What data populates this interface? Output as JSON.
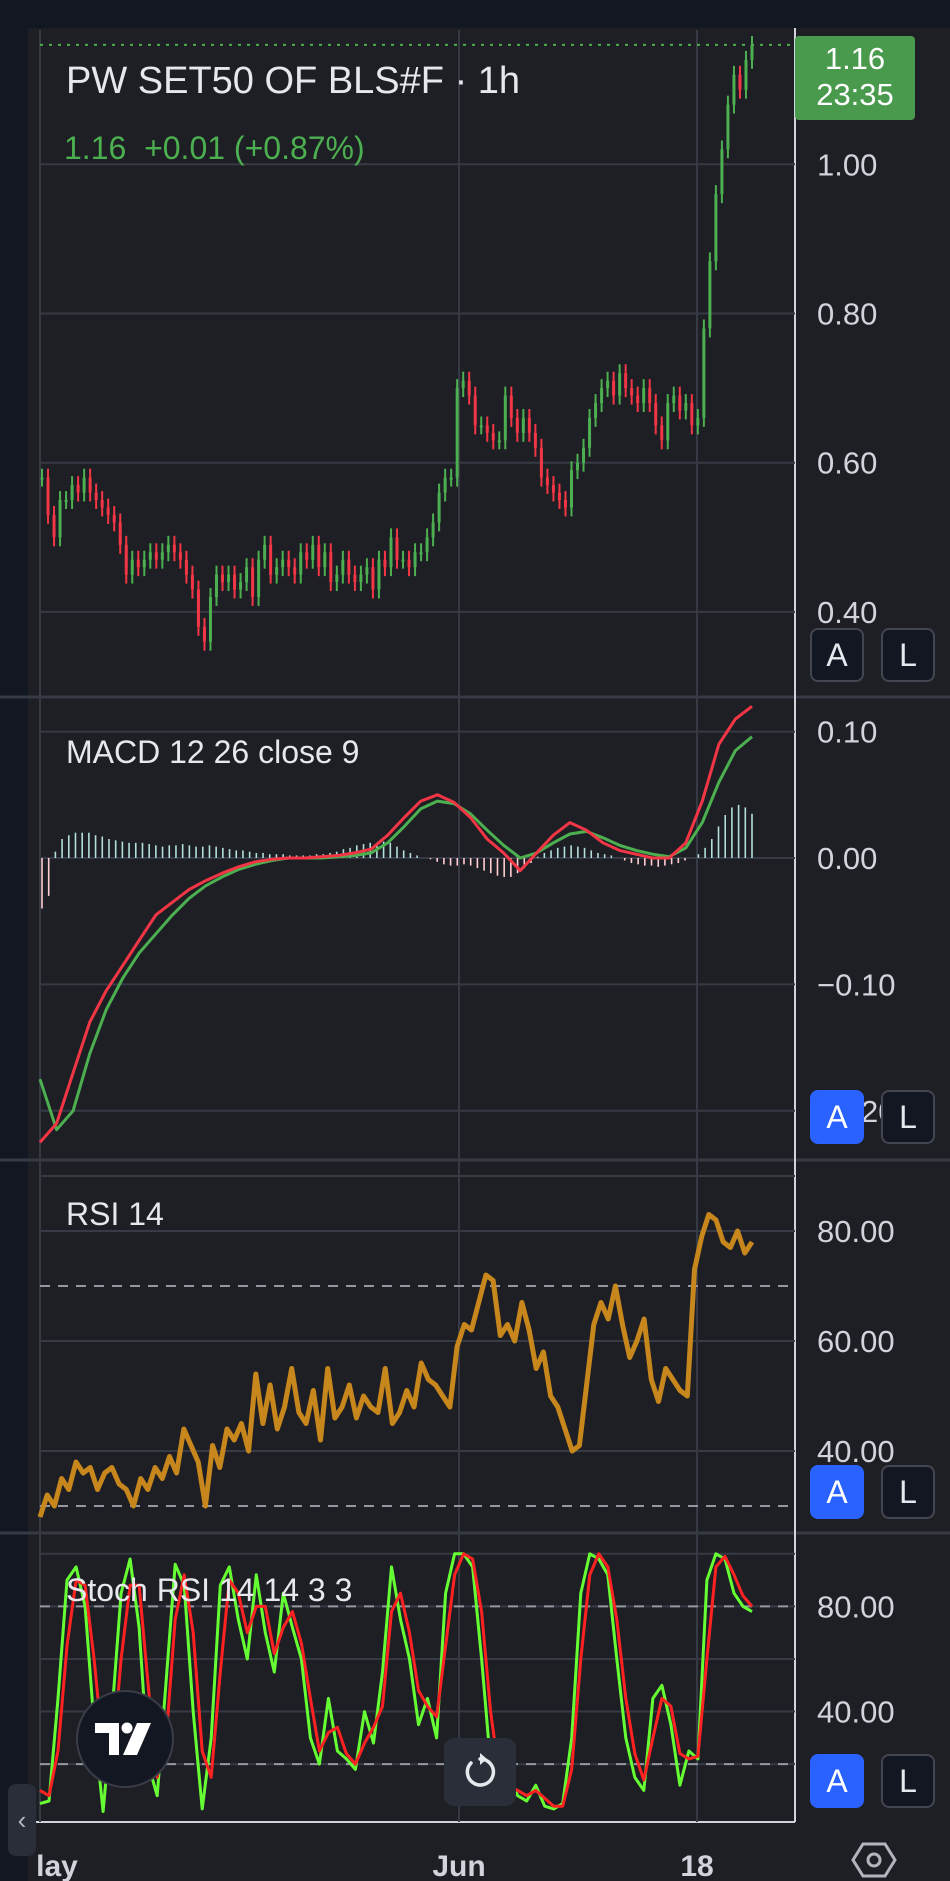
{
  "colors": {
    "background": "#1e1f24",
    "grid": "#363a45",
    "up": "#4caf50",
    "down": "#f23645",
    "macd": "#f23645",
    "signal": "#4caf50",
    "rsi": "#c7871c",
    "stoch_k": "#66ff33",
    "stoch_d": "#ff2222",
    "price_badge": "#4a9a4e",
    "button_active": "#2962ff"
  },
  "header": {
    "symbol": "PW SET50 OF BLS#F",
    "separator": "·",
    "interval": "1h",
    "last": "1.16",
    "change": "+0.01",
    "change_pct": "(+0.87%)"
  },
  "price_badge": {
    "price": "1.16",
    "countdown": "23:35"
  },
  "panes": {
    "macd_legend": "MACD 12 26 close 9",
    "rsi_legend": "RSI 14",
    "stoch_legend": "Stoch RSI 14 14 3 3",
    "btn_a": "A",
    "btn_l": "L"
  },
  "chart_data": [
    {
      "type": "candlestick",
      "title": "PW SET50 OF BLS#F · 1h",
      "y_ticks": [
        "1.00",
        "0.80",
        "0.60",
        "0.40"
      ],
      "ylim": [
        0.29,
        1.18
      ],
      "x_ticks": [
        "lay",
        "Jun",
        "18"
      ],
      "last_price": 1.16,
      "close_series": [
        0.58,
        0.53,
        0.5,
        0.55,
        0.55,
        0.57,
        0.56,
        0.58,
        0.56,
        0.55,
        0.54,
        0.53,
        0.52,
        0.49,
        0.45,
        0.47,
        0.46,
        0.47,
        0.48,
        0.47,
        0.48,
        0.49,
        0.48,
        0.47,
        0.45,
        0.43,
        0.38,
        0.36,
        0.42,
        0.45,
        0.44,
        0.45,
        0.43,
        0.44,
        0.46,
        0.42,
        0.47,
        0.49,
        0.45,
        0.46,
        0.47,
        0.46,
        0.45,
        0.48,
        0.47,
        0.49,
        0.46,
        0.48,
        0.44,
        0.45,
        0.47,
        0.45,
        0.44,
        0.45,
        0.46,
        0.43,
        0.47,
        0.46,
        0.5,
        0.47,
        0.47,
        0.46,
        0.48,
        0.48,
        0.5,
        0.52,
        0.56,
        0.58,
        0.58,
        0.7,
        0.71,
        0.69,
        0.65,
        0.65,
        0.64,
        0.63,
        0.63,
        0.69,
        0.66,
        0.64,
        0.66,
        0.64,
        0.62,
        0.58,
        0.57,
        0.56,
        0.55,
        0.54,
        0.59,
        0.6,
        0.62,
        0.66,
        0.68,
        0.7,
        0.71,
        0.69,
        0.72,
        0.7,
        0.69,
        0.68,
        0.7,
        0.68,
        0.65,
        0.63,
        0.68,
        0.69,
        0.67,
        0.68,
        0.65,
        0.66,
        0.78,
        0.87,
        0.96,
        1.02,
        1.08,
        1.12,
        1.1,
        1.14,
        1.16
      ]
    },
    {
      "type": "line",
      "title": "MACD 12 26 close 9",
      "y_ticks": [
        "0.10",
        "0.00",
        "−0.10",
        "−0.20"
      ],
      "ylim": [
        -0.235,
        0.125
      ],
      "series": [
        {
          "values": [
            -0.225,
            -0.21,
            -0.17,
            -0.13,
            -0.105,
            -0.085,
            -0.065,
            -0.045,
            -0.035,
            -0.025,
            -0.018,
            -0.012,
            -0.007,
            -0.003,
            -0.001,
            0.0,
            0.0,
            0.001,
            0.002,
            0.004,
            0.007,
            0.018,
            0.032,
            0.045,
            0.05,
            0.044,
            0.032,
            0.015,
            0.004,
            -0.01,
            0.004,
            0.018,
            0.028,
            0.022,
            0.012,
            0.006,
            0.003,
            0.0,
            0.0,
            0.012,
            0.045,
            0.09,
            0.11,
            0.12
          ]
        },
        {
          "values": [
            -0.175,
            -0.215,
            -0.2,
            -0.155,
            -0.12,
            -0.095,
            -0.075,
            -0.06,
            -0.045,
            -0.032,
            -0.022,
            -0.015,
            -0.009,
            -0.005,
            -0.002,
            0.0,
            0.0,
            0.0,
            0.001,
            0.002,
            0.004,
            0.012,
            0.025,
            0.039,
            0.045,
            0.043,
            0.035,
            0.022,
            0.01,
            0.0,
            0.004,
            0.012,
            0.019,
            0.021,
            0.016,
            0.01,
            0.006,
            0.003,
            0.001,
            0.008,
            0.028,
            0.06,
            0.085,
            0.096
          ]
        }
      ],
      "histogram": [
        -0.04,
        -0.03,
        0.005,
        0.015,
        0.018,
        0.02,
        0.02,
        0.02,
        0.018,
        0.017,
        0.015,
        0.014,
        0.013,
        0.012,
        0.012,
        0.012,
        0.011,
        0.01,
        0.009,
        0.01,
        0.01,
        0.011,
        0.01,
        0.009,
        0.009,
        0.01,
        0.009,
        0.008,
        0.007,
        0.006,
        0.006,
        0.005,
        0.004,
        0.004,
        0.003,
        0.003,
        0.003,
        0.002,
        0.002,
        0.002,
        0.002,
        0.003,
        0.003,
        0.004,
        0.005,
        0.007,
        0.008,
        0.01,
        0.011,
        0.012,
        0.012,
        0.013,
        0.012,
        0.009,
        0.006,
        0.004,
        0.002,
        0.0,
        -0.001,
        -0.003,
        -0.005,
        -0.006,
        -0.006,
        -0.005,
        -0.006,
        -0.008,
        -0.01,
        -0.012,
        -0.014,
        -0.015,
        -0.015,
        -0.012,
        -0.008,
        -0.004,
        0.001,
        0.004,
        0.006,
        0.008,
        0.009,
        0.01,
        0.009,
        0.008,
        0.006,
        0.004,
        0.003,
        0.002,
        0.0,
        -0.002,
        -0.004,
        -0.005,
        -0.006,
        -0.006,
        -0.007,
        -0.006,
        -0.005,
        -0.004,
        -0.002,
        0.0,
        0.003,
        0.008,
        0.015,
        0.025,
        0.034,
        0.04,
        0.042,
        0.04,
        0.035
      ]
    },
    {
      "type": "line",
      "title": "RSI 14",
      "y_ticks": [
        "80.00",
        "60.00",
        "40.00"
      ],
      "ylim": [
        26,
        92
      ],
      "bands": [
        70,
        30
      ],
      "values": [
        28,
        32,
        30,
        35,
        33,
        38,
        36,
        37,
        33,
        36,
        37,
        34,
        33,
        30,
        35,
        33,
        37,
        35,
        39,
        36,
        44,
        41,
        38,
        30,
        41,
        37,
        44,
        42,
        45,
        40,
        54,
        45,
        52,
        44,
        48,
        55,
        47,
        45,
        51,
        42,
        55,
        46,
        48,
        52,
        46,
        50,
        48,
        47,
        55,
        45,
        47,
        51,
        48,
        56,
        53,
        52,
        50,
        48,
        59,
        63,
        62,
        67,
        72,
        71,
        61,
        63,
        60,
        67,
        62,
        55,
        58,
        50,
        48,
        44,
        40,
        41,
        52,
        63,
        67,
        64,
        70,
        63,
        57,
        60,
        64,
        53,
        49,
        55,
        53,
        51,
        50,
        73,
        79,
        83,
        82,
        78,
        77,
        80,
        76,
        78
      ]
    },
    {
      "type": "line",
      "title": "Stoch RSI 14 14 3 3",
      "y_ticks": [
        "80.00",
        "40.00"
      ],
      "ylim": [
        -2,
        106
      ],
      "bands": [
        80,
        20
      ],
      "series": [
        {
          "values": [
            5,
            6,
            45,
            90,
            95,
            80,
            35,
            2,
            40,
            85,
            98,
            72,
            20,
            8,
            52,
            96,
            88,
            40,
            3,
            30,
            88,
            95,
            75,
            60,
            92,
            70,
            55,
            85,
            72,
            60,
            30,
            20,
            45,
            25,
            22,
            18,
            40,
            28,
            55,
            95,
            75,
            60,
            35,
            45,
            30,
            85,
            100,
            100,
            95,
            60,
            20,
            5,
            15,
            8,
            6,
            12,
            4,
            3,
            5,
            30,
            85,
            100,
            98,
            92,
            60,
            30,
            15,
            10,
            45,
            50,
            35,
            12,
            25,
            22,
            90,
            100,
            98,
            85,
            80,
            78
          ]
        },
        {
          "values": [
            10,
            8,
            25,
            65,
            90,
            88,
            60,
            25,
            20,
            60,
            88,
            88,
            50,
            15,
            30,
            75,
            92,
            70,
            25,
            15,
            55,
            90,
            85,
            70,
            80,
            80,
            62,
            72,
            78,
            66,
            45,
            25,
            32,
            34,
            24,
            20,
            28,
            34,
            42,
            78,
            85,
            70,
            48,
            42,
            38,
            65,
            92,
            100,
            98,
            78,
            40,
            15,
            12,
            10,
            8,
            10,
            7,
            4,
            4,
            18,
            60,
            92,
            100,
            95,
            75,
            45,
            24,
            14,
            30,
            45,
            42,
            24,
            22,
            23,
            60,
            95,
            99,
            92,
            84,
            80
          ]
        }
      ]
    }
  ]
}
